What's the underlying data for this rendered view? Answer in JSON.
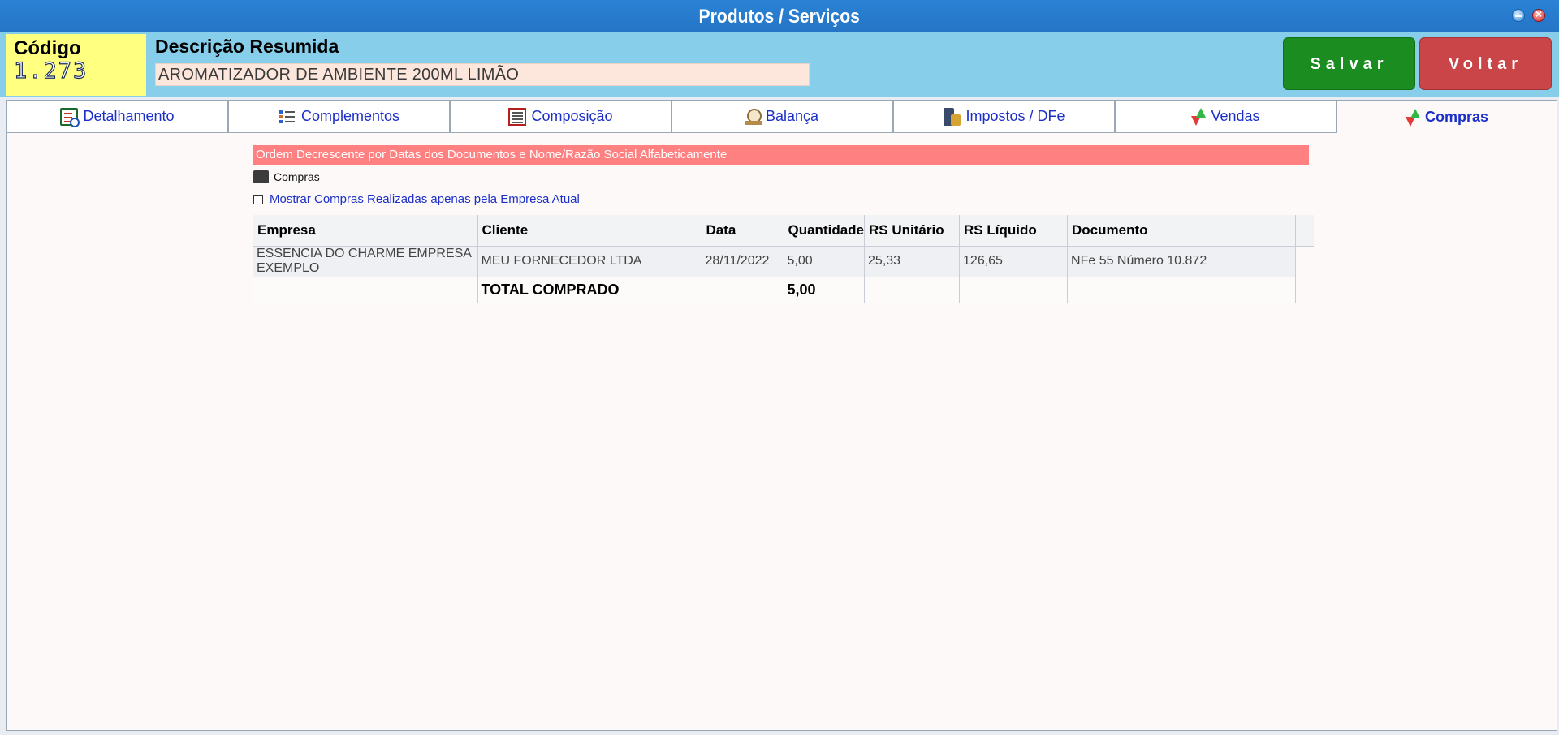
{
  "window": {
    "title": "Produtos / Serviços"
  },
  "header": {
    "code_label": "Código",
    "code_value": "1.273",
    "desc_label": "Descrição Resumida",
    "desc_value": "AROMATIZADOR DE AMBIENTE 200ML LIMÃO",
    "save_label": "Salvar",
    "back_label": "Voltar"
  },
  "tabs": [
    {
      "label": "Detalhamento",
      "icon": "detail-icon"
    },
    {
      "label": "Complementos",
      "icon": "list-icon"
    },
    {
      "label": "Composição",
      "icon": "composition-icon"
    },
    {
      "label": "Balança",
      "icon": "scale-icon"
    },
    {
      "label": "Impostos / DFe",
      "icon": "tax-icon"
    },
    {
      "label": "Vendas",
      "icon": "arrows-icon"
    },
    {
      "label": "Compras",
      "icon": "arrows-icon",
      "active": true
    }
  ],
  "banner": "Ordem Decrescente por Datas dos Documentos e Nome/Razão Social Alfabeticamente",
  "legend": {
    "label": "Compras",
    "color": "#3c3c3c"
  },
  "filter_checkbox": {
    "label": "Mostrar Compras Realizadas apenas pela Empresa Atual",
    "checked": false
  },
  "table": {
    "columns": [
      "Empresa",
      "Cliente",
      "Data",
      "Quantidade",
      "RS Unitário",
      "RS Líquido",
      "Documento"
    ],
    "rows": [
      [
        "ESSENCIA DO CHARME EMPRESA EXEMPLO",
        "MEU FORNECEDOR LTDA",
        "28/11/2022",
        "5,00",
        "25,33",
        "126,65",
        "NFe 55 Número 10.872"
      ]
    ],
    "total": {
      "label": "TOTAL COMPRADO",
      "quantity": "5,00"
    }
  },
  "colors": {
    "titlebar": "#2575c6",
    "header": "#87ceeb",
    "code_box": "#ffff80",
    "save": "#1b8c1f",
    "back": "#c94548",
    "banner": "#ff8080",
    "tab_text": "#1c2fc8"
  }
}
